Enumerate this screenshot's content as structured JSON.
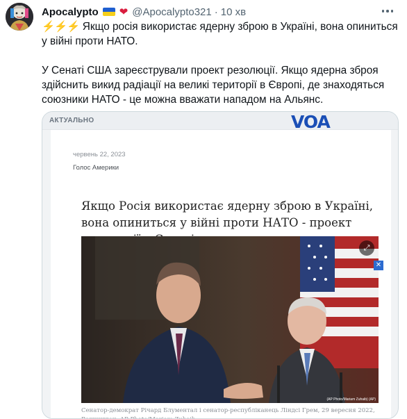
{
  "tweet": {
    "author_name": "Apocalypto",
    "handle": "@Apocalypto321",
    "time": "10 хв",
    "emoji": "⚡⚡⚡",
    "line1": "Якщо росія використає ядерну зброю в Україні, вона опиниться у війні проти НАТО.",
    "paragraph2": "У Сенаті США зареєстрували проект резолюції. Якщо ядерна зброя здійснить викид радіації на великі території в Європі, де знаходяться союзники НАТО - це можна вважати нападом на Альянс."
  },
  "card": {
    "kicker": "АКТУАЛЬНО",
    "logo": "VOA",
    "date": "червень 22, 2023",
    "source": "Голос Америки",
    "headline": "Якщо Росія використає ядерну зброю в Україні, вона опиниться у війні проти НАТО - проект резолюції у Сенаті",
    "photo_credit": "(AP Photo/Mariam Zuhaib) (AP)",
    "caption": "Сенатор-демократ Річард Блументал і сенатор-республіканець Ліндсі Грем, 29 вересня 2022, Вашингтон. AP Photo/Mariam Zuhaib"
  },
  "icons": {
    "verified_flag": "ukraine-flag-icon",
    "heart": "heart-icon",
    "more": "more-icon",
    "expand": "expand-icon",
    "close": "close-icon"
  },
  "colors": {
    "accent": "#1b4fb6",
    "muted": "#536471"
  }
}
